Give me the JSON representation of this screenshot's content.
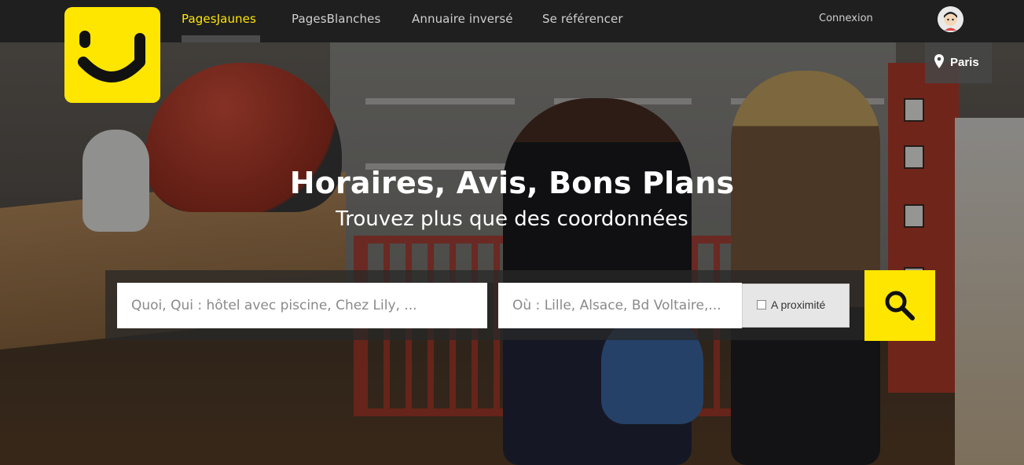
{
  "header": {
    "nav": [
      {
        "label": "PagesJaunes",
        "active": true
      },
      {
        "label": "PagesBlanches",
        "active": false
      },
      {
        "label": "Annuaire inversé",
        "active": false
      },
      {
        "label": "Se référencer",
        "active": false
      }
    ],
    "login_label": "Connexion",
    "location_label": "Paris"
  },
  "hero": {
    "title": "Horaires, Avis, Bons Plans",
    "subtitle": "Trouvez plus que des coordonnées"
  },
  "search": {
    "what_placeholder": "Quoi, Qui : hôtel avec piscine, Chez Lily, ...",
    "where_placeholder": "Où : Lille, Alsace, Bd Voltaire,...",
    "nearby_label": "A proximité",
    "nearby_checked": false
  },
  "colors": {
    "brand_yellow": "#ffe600",
    "topbar": "#1f1f1f",
    "nav_active": "#ffe600",
    "nav_inactive": "#cfcfcf"
  },
  "icons": [
    "smiley-logo-icon",
    "avatar-icon",
    "location-pin-icon",
    "search-icon"
  ]
}
